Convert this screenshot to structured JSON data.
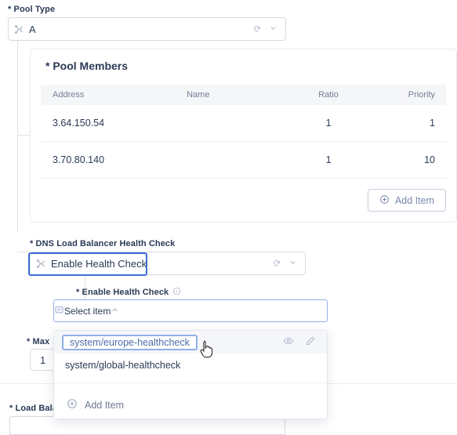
{
  "pool_type": {
    "label": "* Pool Type",
    "value": "A",
    "left_icon": "branch-icon",
    "refresh_icon": "refresh-icon",
    "chevron_icon": "chevron-down-icon"
  },
  "pool_members": {
    "title": "* Pool Members",
    "columns": [
      "Address",
      "Name",
      "Ratio",
      "Priority"
    ],
    "rows": [
      {
        "address": "3.64.150.54",
        "name": "",
        "ratio": "1",
        "priority": "1"
      },
      {
        "address": "3.70.80.140",
        "name": "",
        "ratio": "1",
        "priority": "10"
      }
    ],
    "add_item_label": "Add Item",
    "add_item_icon": "plus-circle-icon"
  },
  "dns_health_check": {
    "label": "* DNS Load Balancer Health Check",
    "value": "Enable Health Check",
    "left_icon": "branch-icon",
    "refresh_icon": "refresh-icon",
    "chevron_icon": "chevron-down-icon"
  },
  "enable_health_check": {
    "label": "* Enable Health Check",
    "info_icon": "info-icon",
    "placeholder": "Select item",
    "left_icon": "select-item-icon",
    "chevron_icon": "chevron-up-icon"
  },
  "dropdown": {
    "options": [
      {
        "text": "system/europe-healthcheck",
        "selected": true,
        "view_icon": "eye-icon",
        "edit_icon": "pencil-icon"
      },
      {
        "text": "system/global-healthcheck",
        "selected": false
      }
    ],
    "add_item_label": "Add Item",
    "add_item_icon": "plus-circle-icon"
  },
  "max_field": {
    "label": "* Max",
    "value": "1"
  },
  "load_balancer": {
    "label": "* Load Bala"
  },
  "cursor": {
    "icon": "pointer-hand-cursor"
  },
  "colors": {
    "accent_blue": "#3b6fd4",
    "field_border_blue": "#8fb0e8",
    "text": "#2b3a55",
    "muted": "#737e95",
    "header_bg": "#f5f6f8"
  }
}
